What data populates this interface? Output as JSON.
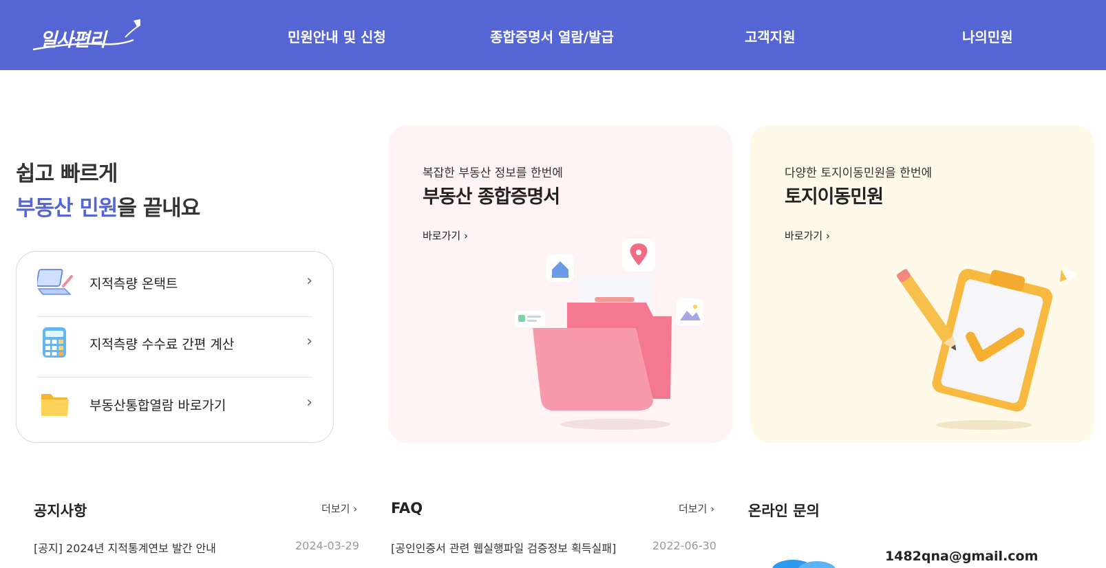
{
  "header": {
    "logo_text": "일사편리",
    "nav": [
      "민원안내 및 신청",
      "종합증명서 열람/발급",
      "고객지원",
      "나의민원"
    ]
  },
  "hero": {
    "line1": "쉽고 빠르게",
    "accent": "부동산 민원",
    "line2_rest": "을 끝내요"
  },
  "quick_links": [
    {
      "label": "지적측량 온택트",
      "icon": "laptop-icon"
    },
    {
      "label": "지적측량 수수료 간편 계산",
      "icon": "calculator-icon"
    },
    {
      "label": "부동산통합열람 바로가기",
      "icon": "folder-icon"
    }
  ],
  "cards": [
    {
      "sub": "복잡한 부동산 정보를 한번에",
      "title": "부동산 종합증명서",
      "go": "바로가기"
    },
    {
      "sub": "다양한 토지이동민원을 한번에",
      "title": "토지이동민원",
      "go": "바로가기"
    }
  ],
  "notice": {
    "title": "공지사항",
    "more": "더보기",
    "rows": [
      {
        "text": "[공지] 2024년 지적통계연보 발간 안내",
        "date": "2024-03-29"
      }
    ]
  },
  "faq": {
    "title": "FAQ",
    "more": "더보기",
    "rows": [
      {
        "text": "[공인인증서 관련 웹실행파일 검증정보 획득실패]",
        "date": "2022-06-30"
      }
    ]
  },
  "inquiry": {
    "title": "온라인 문의",
    "email": "1482qna@gmail.com"
  },
  "colors": {
    "brand": "#5566d4",
    "card_pink": "#fff3f4",
    "card_yellow": "#fff9ea"
  }
}
